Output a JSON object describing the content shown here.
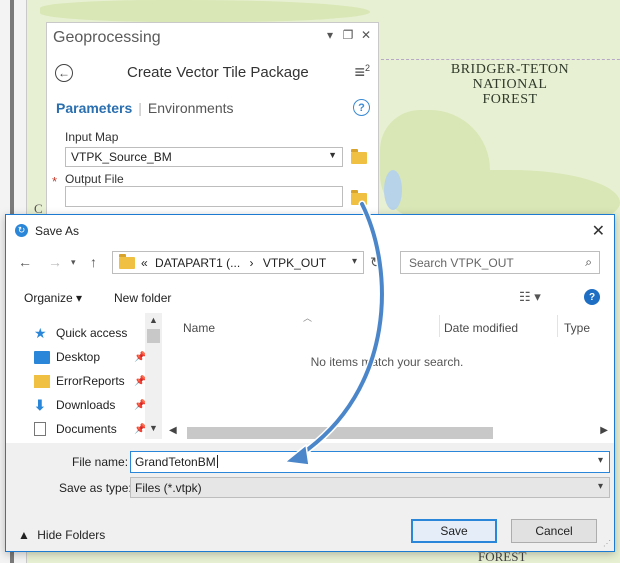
{
  "map": {
    "forest_label_lines": [
      "BRIDGER-TETON",
      "NATIONAL",
      "FOREST"
    ],
    "forest_label_bottom": "FOREST",
    "partial_label_left": "C"
  },
  "geoprocessing": {
    "title": "Geoprocessing",
    "tool_name": "Create Vector Tile Package",
    "tabs": {
      "parameters": "Parameters",
      "environments": "Environments"
    },
    "input_map_label": "Input Map",
    "input_map_value": "VTPK_Source_BM",
    "output_file_label": "Output File",
    "required_marker": "*",
    "output_file_value": "",
    "menu_badge": "2"
  },
  "dialog": {
    "title": "Save As",
    "address": {
      "root": "«",
      "part1": "DATAPART1 (...",
      "sep": "›",
      "part2": "VTPK_OUT"
    },
    "search_placeholder": "Search VTPK_OUT",
    "toolbar": {
      "organize": "Organize",
      "new_folder": "New folder"
    },
    "nav_items": [
      {
        "label": "Quick access",
        "icon": "star-icon",
        "pinned": false
      },
      {
        "label": "Desktop",
        "icon": "desktop-icon",
        "pinned": true
      },
      {
        "label": "ErrorReports",
        "icon": "folder-icon",
        "pinned": true
      },
      {
        "label": "Downloads",
        "icon": "download-icon",
        "pinned": true
      },
      {
        "label": "Documents",
        "icon": "documents-icon",
        "pinned": true
      }
    ],
    "columns": {
      "name": "Name",
      "date_modified": "Date modified",
      "type": "Type"
    },
    "empty_message": "No items match your search.",
    "file_name_label": "File name:",
    "file_name_value": "GrandTetonBM",
    "save_as_type_label": "Save as type:",
    "save_as_type_value": "Files (*.vtpk)",
    "hide_folders": "Hide Folders",
    "save_button": "Save",
    "cancel_button": "Cancel"
  },
  "colors": {
    "accent": "#2a86d8",
    "gp_tab_active": "#2a6fb0",
    "map_bg": "#e8f0d3"
  }
}
